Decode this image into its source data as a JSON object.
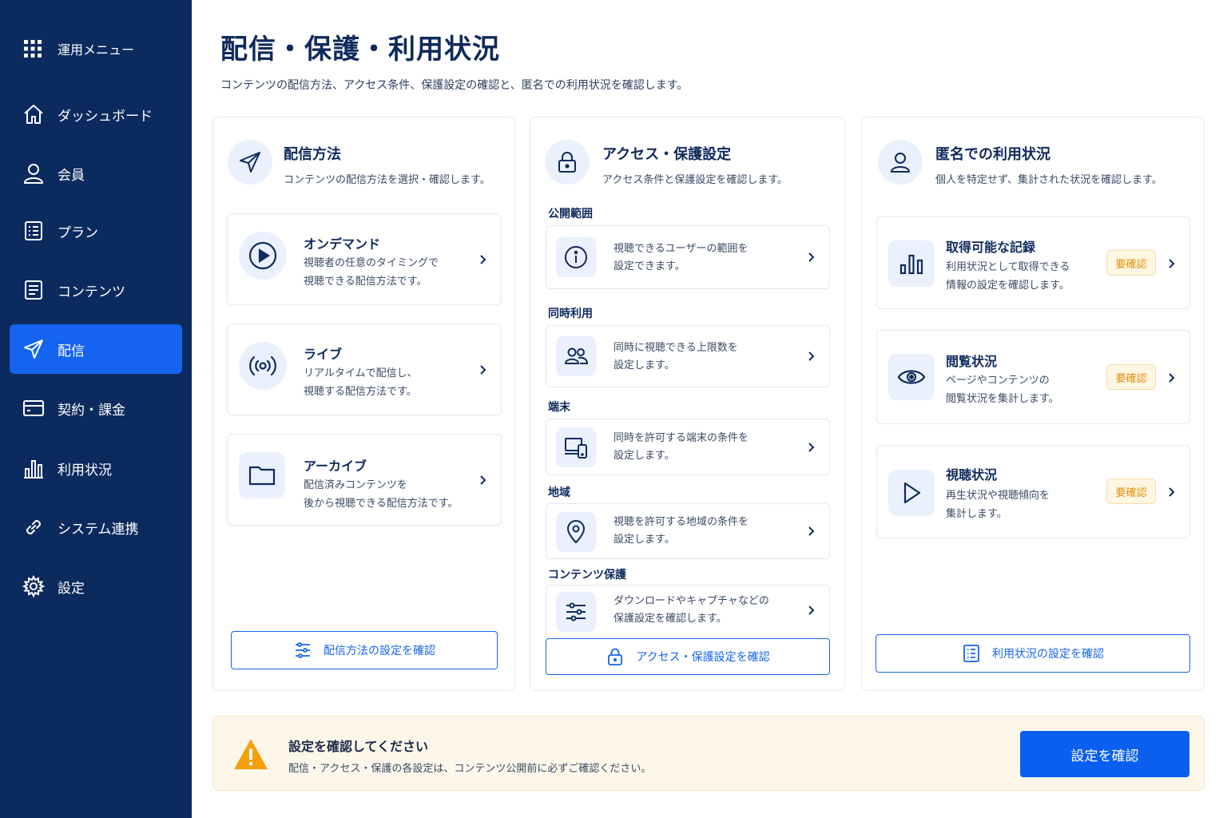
{
  "sidebar": {
    "menu_label": "運用メニュー",
    "items": [
      {
        "label": "ダッシュボード",
        "icon": "home-icon"
      },
      {
        "label": "会員",
        "icon": "user-icon"
      },
      {
        "label": "プラン",
        "icon": "list-icon"
      },
      {
        "label": "コンテンツ",
        "icon": "document-icon"
      },
      {
        "label": "配信",
        "icon": "send-icon",
        "active": true
      },
      {
        "label": "契約・課金",
        "icon": "card-icon"
      },
      {
        "label": "利用状況",
        "icon": "bar-chart-icon"
      },
      {
        "label": "システム連携",
        "icon": "link-icon"
      },
      {
        "label": "設定",
        "icon": "gear-icon"
      }
    ]
  },
  "header": {
    "title": "配信・保護・利用状況",
    "description": "コンテンツの配信方法、アクセス条件、保護設定の確認と、匿名での利用状況を確認します。"
  },
  "delivery": {
    "title": "配信方法",
    "subtitle": "コンテンツの配信方法を選択・確認します。",
    "options": [
      {
        "title": "オンデマンド",
        "line1": "視聴者の任意のタイミングで",
        "line2": "視聴できる配信方法です。"
      },
      {
        "title": "ライブ",
        "line1": "リアルタイムで配信し、",
        "line2": "視聴する配信方法です。"
      },
      {
        "title": "アーカイブ",
        "line1": "配信済みコンテンツを",
        "line2": "後から視聴できる配信方法です。"
      }
    ],
    "button": "配信方法の設定を確認"
  },
  "access": {
    "title": "アクセス・保護設定",
    "subtitle": "アクセス条件と保護設定を確認します。",
    "sections": [
      {
        "label": "公開範囲",
        "line1": "視聴できるユーザーの範囲を",
        "line2": "設定できます。"
      },
      {
        "label": "同時利用",
        "line1": "同時に視聴できる上限数を",
        "line2": "設定します。"
      },
      {
        "label": "端末",
        "line1": "同時を許可する端末の条件を",
        "line2": "設定します。"
      },
      {
        "label": "地域",
        "line1": "視聴を許可する地域の条件を",
        "line2": "設定します。"
      },
      {
        "label": "コンテンツ保護",
        "line1": "ダウンロードやキャプチャなどの",
        "line2": "保護設定を確認します。"
      }
    ],
    "button": "アクセス・保護設定を確認"
  },
  "usage": {
    "title": "匿名での利用状況",
    "subtitle": "個人を特定せず、集計された状況を確認します。",
    "items": [
      {
        "title": "取得可能な記録",
        "line1": "利用状況として取得できる",
        "line2": "情報の設定を確認します。",
        "badge": "要確認"
      },
      {
        "title": "閲覧状況",
        "line1": "ページやコンテンツの",
        "line2": "閲覧状況を集計します。",
        "badge": "要確認"
      },
      {
        "title": "視聴状況",
        "line1": "再生状況や視聴傾向を",
        "line2": "集計します。",
        "badge": "要確認"
      }
    ],
    "button": "利用状況の設定を確認"
  },
  "notice": {
    "title": "設定を確認してください",
    "description": "配信・アクセス・保護の各設定は、コンテンツ公開前に必ずご確認ください。",
    "button": "設定を確認"
  },
  "colors": {
    "sidebar": "#0b2a5e",
    "accent": "#1464f0",
    "warning": "#f5a00a"
  }
}
